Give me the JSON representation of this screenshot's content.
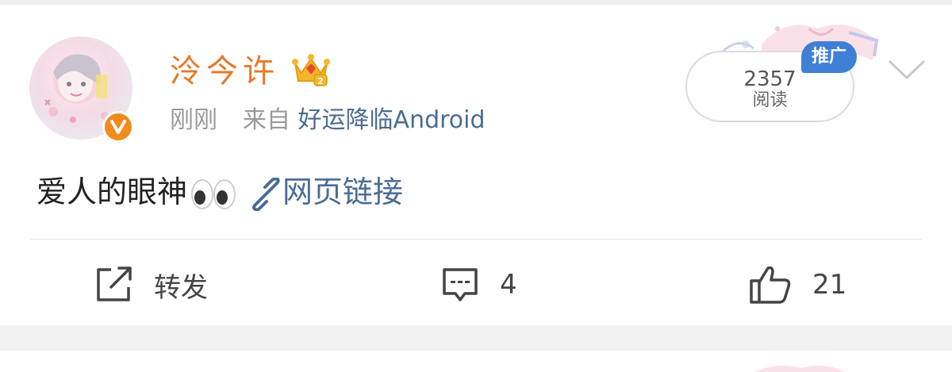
{
  "post": {
    "author": {
      "name": "泠今许",
      "verified_icon": "v-verified-icon",
      "badge_icon": "crown-level-2-icon"
    },
    "time": "刚刚",
    "source_prefix": "来自",
    "source_app": "好运降临Android",
    "read_count": "2357",
    "read_label": "阅读",
    "promo_label": "推广",
    "content_text": "爱人的眼神",
    "content_emoji": "eyes-emoji",
    "link_label": "网页链接"
  },
  "actions": {
    "repost_label": "转发",
    "comment_count": "4",
    "like_count": "21"
  },
  "colors": {
    "username": "#e8792a",
    "link": "#4b6c93",
    "verified": "#f28a1e",
    "promo": "#3f7fd6"
  }
}
